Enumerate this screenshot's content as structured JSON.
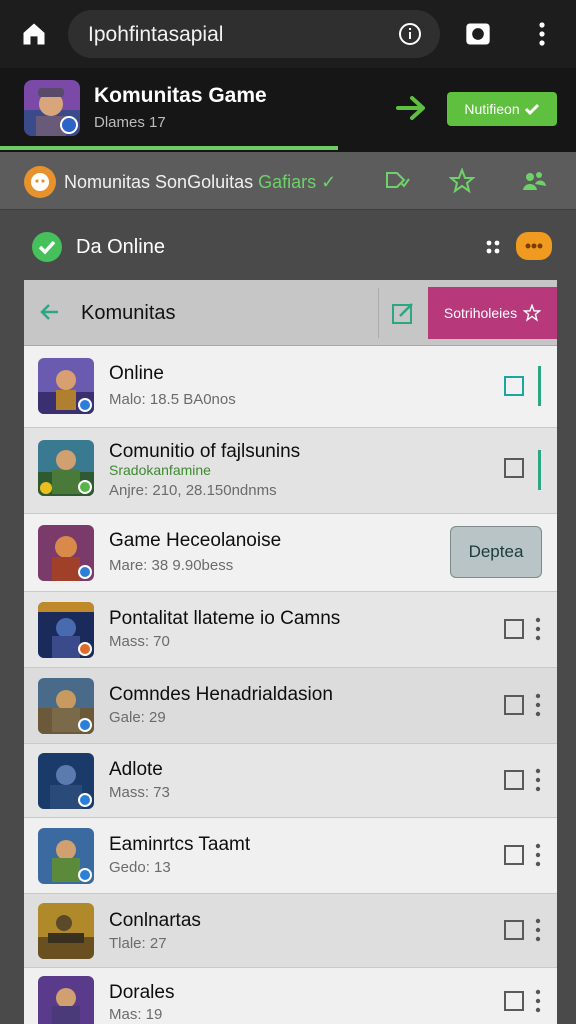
{
  "browser": {
    "url_text": "Ipohfintasapial"
  },
  "app": {
    "title": "Komunitas Game",
    "subtitle": "Dlames 17",
    "notify_button": "Nutifieon"
  },
  "strip": {
    "label": "Nomunitas SonGoluitas",
    "label_green": "Gafiars ✓",
    "icons": [
      "tag-check-icon",
      "star-icon",
      "people-icon"
    ]
  },
  "online": {
    "label": "Da Online"
  },
  "panel": {
    "title": "Komunitas",
    "action_button": "Sotriholeies"
  },
  "rows": [
    {
      "name": "Online",
      "meta": "Malo: 18.5 BA0nos",
      "sub": "",
      "control": "checkbox-teal"
    },
    {
      "name": "Comunitio of fajlsunins",
      "sub": "Sradokanfamine",
      "meta": "Anjre: 210, 28.150ndnms",
      "control": "checkbox"
    },
    {
      "name": "Game Heceolanoise",
      "meta": "Mare: 38 9.90bess",
      "sub": "",
      "control": "button",
      "button_label": "Deptea"
    },
    {
      "name": "Pontalitat llateme io Camns",
      "meta": "Mass: 70",
      "sub": "",
      "control": "checkbox-menu"
    },
    {
      "name": "Comndes Henadrialdasion",
      "meta": "Gale: 29",
      "sub": "",
      "control": "checkbox-menu"
    },
    {
      "name": "Adlote",
      "meta": "Mass: 73",
      "sub": "",
      "control": "checkbox-menu"
    },
    {
      "name": "Eaminrtcs Taamt",
      "meta": "Gedo: 13",
      "sub": "",
      "control": "checkbox-menu"
    },
    {
      "name": "Conlnartas",
      "meta": "Tlale: 27",
      "sub": "",
      "control": "checkbox-menu"
    },
    {
      "name": "Dorales",
      "meta": "Mas: 19",
      "sub": "",
      "control": "checkbox-menu"
    }
  ]
}
